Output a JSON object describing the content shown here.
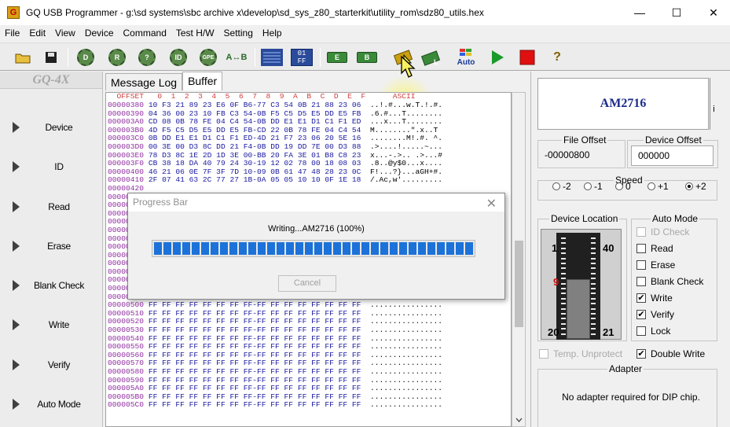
{
  "window": {
    "title": "GQ USB Programmer - g:\\sd systems\\sbc archive x\\develop\\sd_sys_z80_starterkit\\utility_rom\\sdz80_utils.hex",
    "controls": {
      "minimize": "—",
      "maximize": "☐",
      "close": "✕"
    }
  },
  "menu": [
    "File",
    "Edit",
    "View",
    "Device",
    "Command",
    "Test H/W",
    "Setting",
    "Help"
  ],
  "toolbar": {
    "icons": [
      "open-folder-icon",
      "save-disk-icon",
      "device-gear-icon",
      "read-gear-icon",
      "blank-check-gear-icon",
      "id-gear-icon",
      "gpe-gear-icon",
      "a-to-b-icon",
      "buffer-grid-icon",
      "hex-01ff-icon",
      "erase-chip-icon",
      "blank-chip-icon",
      "write-chip-icon",
      "verify-chip-icon",
      "auto-icon",
      "run-icon",
      "stop-icon",
      "help-icon"
    ],
    "labels": {
      "d": "D",
      "r": "R",
      "q": "?",
      "id": "ID",
      "gpe": "GPE",
      "ab": "A↔B",
      "hex_top": "01",
      "hex_bot": "FF",
      "e": "E",
      "b": "B",
      "auto": "Auto",
      "help": "?"
    },
    "colors": {
      "run": "#1a9a2a",
      "stop": "#e01010",
      "help": "#806000"
    }
  },
  "sidebar": {
    "logo": "GQ-4X",
    "items": [
      "Device",
      "ID",
      "Read",
      "Erase",
      "Blank Check",
      "Write",
      "Verify",
      "Auto Mode"
    ]
  },
  "tabs": [
    "Message Log",
    "Buffer"
  ],
  "hex": {
    "header": "  OFFSET   0  1  2  3  4  5  6  7  8  9  A  B  C  D  E  F      ASCII",
    "rows": [
      {
        "addr": "00000380",
        "bytes": "10 F3 21 89 23 E6 0F B6-77 C3 54 0B 21 88 23 06",
        "ascii": "..!.#...w.T.!.#."
      },
      {
        "addr": "00000390",
        "bytes": "04 36 00 23 10 FB C3 54-0B F5 C5 D5 E5 DD E5 FB",
        "ascii": ".6.#...T........"
      },
      {
        "addr": "000003A0",
        "bytes": "CD 08 0B 78 FE 04 C4 54-0B DD E1 E1 D1 C1 F1 ED",
        "ascii": "...x...T........"
      },
      {
        "addr": "000003B0",
        "bytes": "4D F5 C5 D5 E5 DD E5 FB-CD 22 0B 78 FE 04 C4 54",
        "ascii": "M........\".x..T"
      },
      {
        "addr": "000003C0",
        "bytes": "0B DD E1 E1 D1 C1 F1 ED-4D 21 F7 23 06 20 5E 16",
        "ascii": "........M!.#. ^."
      },
      {
        "addr": "000003D0",
        "bytes": "00 3E 00 D3 8C DD 21 F4-0B DD 19 DD 7E 00 D3 88",
        "ascii": ".>....!.....~..."
      },
      {
        "addr": "000003E0",
        "bytes": "78 D3 8C 1E 2D 1D 3E 00-BB 20 FA 3E 01 B8 C8 23",
        "ascii": "x...-.>.. .>...#"
      },
      {
        "addr": "000003F0",
        "bytes": "CB 38 18 DA 40 79 24 30-19 12 02 78 00 18 08 03",
        "ascii": ".8..@y$0...x...."
      },
      {
        "addr": "00000400",
        "bytes": "46 21 06 0E 7F 3F 7D 10-09 0B 61 47 48 28 23 0C",
        "ascii": "F!...?}...aGH+#."
      },
      {
        "addr": "00000410",
        "bytes": "2F 07 41 63 2C 77 27 1B-0A 05 05 10 10 0F 1E 18",
        "ascii": "/.Ac,w'........."
      },
      {
        "addr": "00000420",
        "bytes": "",
        "ascii": ""
      },
      {
        "addr": "00000430",
        "bytes": "",
        "ascii": ""
      },
      {
        "addr": "00000440",
        "bytes": "",
        "ascii": ""
      },
      {
        "addr": "00000450",
        "bytes": "",
        "ascii": ""
      },
      {
        "addr": "00000460",
        "bytes": "",
        "ascii": ""
      },
      {
        "addr": "00000470",
        "bytes": "",
        "ascii": ""
      },
      {
        "addr": "00000480",
        "bytes": "",
        "ascii": ""
      },
      {
        "addr": "00000490",
        "bytes": "",
        "ascii": ""
      },
      {
        "addr": "000004A0",
        "bytes": "",
        "ascii": ""
      },
      {
        "addr": "000004B0",
        "bytes": "",
        "ascii": ""
      },
      {
        "addr": "000004C0",
        "bytes": "",
        "ascii": ""
      },
      {
        "addr": "000004D0",
        "bytes": "",
        "ascii": ""
      },
      {
        "addr": "000004E0",
        "bytes": "",
        "ascii": ""
      },
      {
        "addr": "000004F0",
        "bytes": "FF FF FF FF FF FF FF FF-FF FF FF FF FF FF FF FF",
        "ascii": "................"
      },
      {
        "addr": "00000500",
        "bytes": "FF FF FF FF FF FF FF FF-FF FF FF FF FF FF FF FF",
        "ascii": "................"
      },
      {
        "addr": "00000510",
        "bytes": "FF FF FF FF FF FF FF FF-FF FF FF FF FF FF FF FF",
        "ascii": "................"
      },
      {
        "addr": "00000520",
        "bytes": "FF FF FF FF FF FF FF FF-FF FF FF FF FF FF FF FF",
        "ascii": "................"
      },
      {
        "addr": "00000530",
        "bytes": "FF FF FF FF FF FF FF FF-FF FF FF FF FF FF FF FF",
        "ascii": "................"
      },
      {
        "addr": "00000540",
        "bytes": "FF FF FF FF FF FF FF FF-FF FF FF FF FF FF FF FF",
        "ascii": "................"
      },
      {
        "addr": "00000550",
        "bytes": "FF FF FF FF FF FF FF FF-FF FF FF FF FF FF FF FF",
        "ascii": "................"
      },
      {
        "addr": "00000560",
        "bytes": "FF FF FF FF FF FF FF FF-FF FF FF FF FF FF FF FF",
        "ascii": "................"
      },
      {
        "addr": "00000570",
        "bytes": "FF FF FF FF FF FF FF FF-FF FF FF FF FF FF FF FF",
        "ascii": "................"
      },
      {
        "addr": "00000580",
        "bytes": "FF FF FF FF FF FF FF FF-FF FF FF FF FF FF FF FF",
        "ascii": "................"
      },
      {
        "addr": "00000590",
        "bytes": "FF FF FF FF FF FF FF FF-FF FF FF FF FF FF FF FF",
        "ascii": "................"
      },
      {
        "addr": "000005A0",
        "bytes": "FF FF FF FF FF FF FF FF-FF FF FF FF FF FF FF FF",
        "ascii": "................"
      },
      {
        "addr": "000005B0",
        "bytes": "FF FF FF FF FF FF FF FF-FF FF FF FF FF FF FF FF",
        "ascii": "................"
      },
      {
        "addr": "000005C0",
        "bytes": "FF FF FF FF FF FF FF FF-FF FF FF FF FF FF FF FF",
        "ascii": "................"
      }
    ]
  },
  "dialog": {
    "title": "Progress Bar",
    "close": "✕",
    "status": "Writing...AM2716 (100%)",
    "progress": 100,
    "cancel": "Cancel"
  },
  "right": {
    "chip": "AM2716",
    "chip_button": "i",
    "file_offset_label": "File Offset",
    "file_offset": "-00000800",
    "device_offset_label": "Device Offset",
    "device_offset": "000000",
    "speed_label": "Speed",
    "speeds": [
      {
        "label": "-2",
        "on": false
      },
      {
        "label": "-1",
        "on": false
      },
      {
        "label": "0",
        "on": false
      },
      {
        "label": "+1",
        "on": false
      },
      {
        "label": "+2",
        "on": true
      }
    ],
    "device_location_label": "Device Location",
    "pins": {
      "p1": "1",
      "p9": "9",
      "p20": "20",
      "p21": "21",
      "p40": "40"
    },
    "pin_highlight_color": "#d01010",
    "auto_mode_label": "Auto Mode",
    "auto_mode": [
      {
        "label": "ID Check",
        "checked": false,
        "disabled": true
      },
      {
        "label": "Read",
        "checked": false,
        "disabled": false
      },
      {
        "label": "Erase",
        "checked": false,
        "disabled": false
      },
      {
        "label": "Blank Check",
        "checked": false,
        "disabled": false
      },
      {
        "label": "Write",
        "checked": true,
        "disabled": false
      },
      {
        "label": "Verify",
        "checked": true,
        "disabled": false
      },
      {
        "label": "Lock",
        "checked": false,
        "disabled": false
      }
    ],
    "temp_unprotect": "Temp. Unprotect",
    "double_write": "Double Write",
    "adapter_label": "Adapter",
    "adapter_text": "No adapter required for DIP chip."
  }
}
